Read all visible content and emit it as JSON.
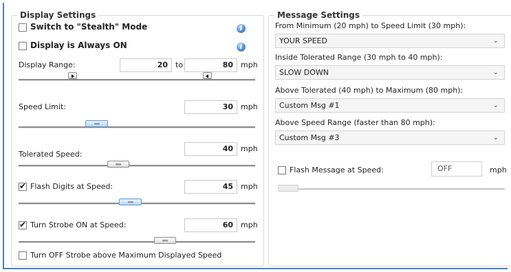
{
  "display": {
    "title": "Display Settings",
    "stealth_label": "Switch to \"Stealth\" Mode",
    "always_on_label": "Display is Always ON",
    "range_label": "Display Range:",
    "range_min": "20",
    "range_to": "to",
    "range_max": "80",
    "unit": "mph",
    "speed_limit_label": "Speed Limit:",
    "speed_limit_value": "30",
    "tolerated_label": "Tolerated Speed:",
    "tolerated_value": "40",
    "flash_digits_label": "Flash Digits at Speed:",
    "flash_digits_value": "45",
    "strobe_label": "Turn Strobe ON at Speed:",
    "strobe_value": "60",
    "strobe_off_label": "Turn OFF Strobe above Maximum Displayed Speed",
    "flash_digits_checked": true,
    "strobe_checked": true,
    "stealth_checked": false,
    "always_on_checked": false,
    "strobe_off_checked": false,
    "info_icon": "info-icon"
  },
  "message": {
    "title": "Message Settings",
    "min_label": "From Minimum (20 mph) to Speed Limit (30 mph):",
    "min_value": "YOUR SPEED",
    "inside_label": "Inside Tolerated Range (30 mph to 40 mph):",
    "inside_value": "SLOW DOWN",
    "above_tol_label": "Above Tolerated (40 mph) to Maximum (80 mph):",
    "above_tol_value": "Custom Msg #1",
    "above_range_label": "Above Speed Range (faster than 80 mph):",
    "above_range_value": "Custom Msg #3",
    "flash_msg_label": "Flash Message at Speed:",
    "flash_msg_value": "OFF",
    "flash_msg_checked": false,
    "unit": "mph"
  },
  "colors": {
    "accent": "#4a7fbf",
    "slider_highlight": "#b9d6f3"
  }
}
